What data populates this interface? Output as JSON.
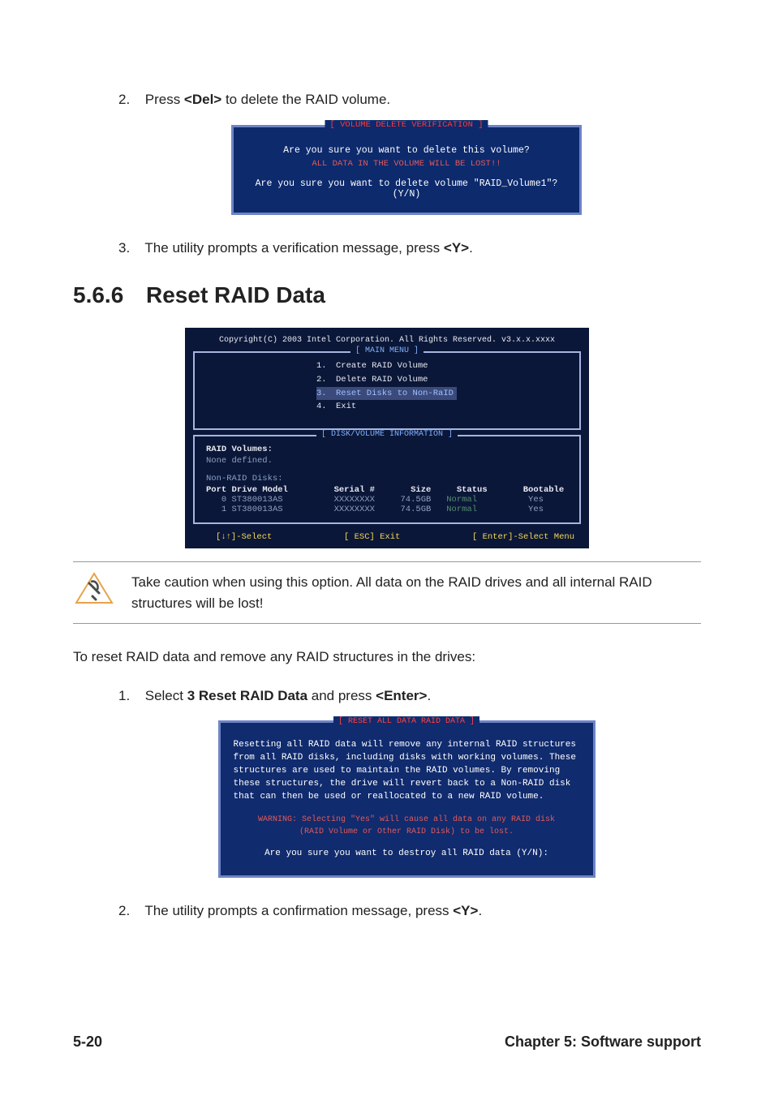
{
  "step2": {
    "num": "2.",
    "prefix": "Press ",
    "key": "<Del>",
    "suffix": " to delete the RAID volume."
  },
  "dialog1": {
    "title": "[ VOLUME DELETE VERIFICATION ]",
    "line1": "Are you sure you want to delete this volume?",
    "warn": "ALL DATA IN THE VOLUME WILL BE LOST!!",
    "line2": "Are you sure you want to delete volume \"RAID_Volume1\"? (Y/N)"
  },
  "step3": {
    "num": "3.",
    "prefix": "The utility prompts a verification message, press ",
    "key": "<Y>",
    "suffix": "."
  },
  "heading": {
    "num": "5.6.6",
    "title": "Reset RAID Data"
  },
  "util": {
    "copyright": "Copyright(C) 2003 Intel Corporation. All Rights Reserved. v3.x.x.xxxx",
    "main_menu_title": "[ MAIN MENU ]",
    "info_title": "[ DISK/VOLUME INFORMATION ]",
    "menu": [
      {
        "num": "1.",
        "label": "Create RAID Volume",
        "selected": false
      },
      {
        "num": "2.",
        "label": "Delete RAID Volume",
        "selected": false
      },
      {
        "num": "3.",
        "label": "Reset Disks to Non-RaID",
        "selected": true
      },
      {
        "num": "4.",
        "label": "Exit",
        "selected": false
      }
    ],
    "raid_volumes_label": "RAID Volumes:",
    "none_defined": "None defined.",
    "non_raid_label": "Non-RAID Disks:",
    "table": {
      "headers": {
        "port": "Port",
        "model": "Drive Model",
        "serial": "Serial #",
        "size": "Size",
        "status": "Status",
        "bootable": "Bootable"
      },
      "rows": [
        {
          "port": "0",
          "model": "ST380013AS",
          "serial": "XXXXXXXX",
          "size": "74.5GB",
          "status": "Normal",
          "bootable": "Yes"
        },
        {
          "port": "1",
          "model": "ST380013AS",
          "serial": "XXXXXXXX",
          "size": "74.5GB",
          "status": "Normal",
          "bootable": "Yes"
        }
      ]
    },
    "footer": {
      "select": "[↓↑]-Select",
      "esc": "[ ESC] Exit",
      "enter": "[ Enter]-Select Menu"
    }
  },
  "note": "Take caution when using this option. All data on the RAID drives and all internal RAID structures will be lost!",
  "intro": "To reset RAID data and remove any RAID structures in the drives:",
  "step1b": {
    "num": "1.",
    "prefix": "Select ",
    "bold1": "3 Reset RAID Data",
    "mid": " and press ",
    "bold2": "<Enter>",
    "suffix": "."
  },
  "reset_dialog": {
    "title": "[ RESET ALL DATA RAID DATA ]",
    "para": "Resetting all RAID data will remove any internal RAID structures from all RAID disks, including disks with working volumes. These structures are used to maintain the RAID volumes. By removing these structures, the drive will revert back to a Non-RAID disk that can then be used or reallocated to a new RAID volume.",
    "warn1": "WARNING: Selecting \"Yes\" will cause all data on any RAID disk",
    "warn2": "(RAID Volume or Other RAID Disk) to be lost.",
    "confirm": "Are you sure you want to destroy all RAID data (Y/N):"
  },
  "step2b": {
    "num": "2.",
    "prefix": "The utility prompts a confirmation message, press ",
    "key": "<Y>",
    "suffix": "."
  },
  "footer": {
    "page": "5-20",
    "chapter": "Chapter 5: Software support"
  }
}
